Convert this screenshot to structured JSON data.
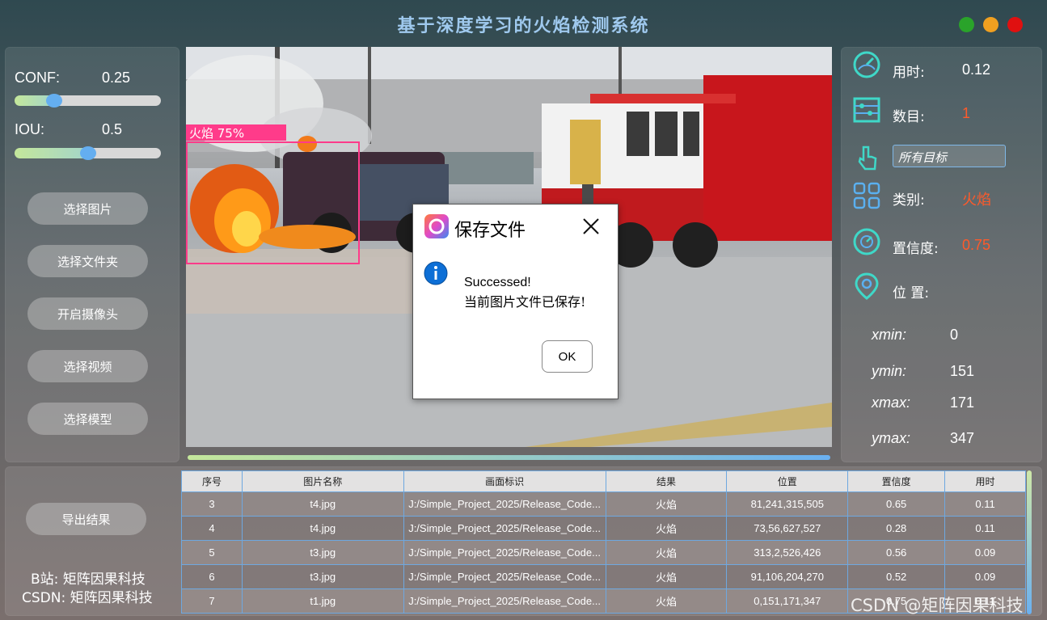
{
  "window": {
    "title": "基于深度学习的火焰检测系统"
  },
  "colors": {
    "dot_green": "#2aa32a",
    "dot_orange": "#f0a020",
    "dot_red": "#e01010",
    "accent": "#ff5a2a"
  },
  "left_panel": {
    "conf_label": "CONF:",
    "conf_value": "0.25",
    "conf_level": 0.25,
    "iou_label": "IOU:",
    "iou_value": "0.5",
    "iou_level": 0.5,
    "buttons": [
      "选择图片",
      "选择文件夹",
      "开启摄像头",
      "选择视频",
      "选择模型"
    ]
  },
  "image_view": {
    "detection_label": "火焰  75%"
  },
  "right_panel": {
    "time_label": "用时:",
    "time_value": "0.12",
    "count_label": "数目:",
    "count_value": "1",
    "target_select": "所有目标",
    "class_label": "类别:",
    "class_value": "火焰",
    "conf_label": "置信度:",
    "conf_value": "0.75",
    "pos_label": "位 置:",
    "coords": [
      {
        "label": "xmin:",
        "value": "0"
      },
      {
        "label": "ymin:",
        "value": "151"
      },
      {
        "label": "xmax:",
        "value": "171"
      },
      {
        "label": "ymax:",
        "value": "347"
      }
    ]
  },
  "bottom_left": {
    "export_button": "导出结果",
    "credit_bilibili": "B站: 矩阵因果科技",
    "credit_csdn": "CSDN: 矩阵因果科技"
  },
  "table": {
    "headers": [
      "序号",
      "图片名称",
      "画面标识",
      "结果",
      "位置",
      "置信度",
      "用时"
    ],
    "rows": [
      [
        "3",
        "t4.jpg",
        "J:/Simple_Project_2025/Release_Code...",
        "火焰",
        "81,241,315,505",
        "0.65",
        "0.11"
      ],
      [
        "4",
        "t4.jpg",
        "J:/Simple_Project_2025/Release_Code...",
        "火焰",
        "73,56,627,527",
        "0.28",
        "0.11"
      ],
      [
        "5",
        "t3.jpg",
        "J:/Simple_Project_2025/Release_Code...",
        "火焰",
        "313,2,526,426",
        "0.56",
        "0.09"
      ],
      [
        "6",
        "t3.jpg",
        "J:/Simple_Project_2025/Release_Code...",
        "火焰",
        "91,106,204,270",
        "0.52",
        "0.09"
      ],
      [
        "7",
        "t1.jpg",
        "J:/Simple_Project_2025/Release_Code...",
        "火焰",
        "0,151,171,347",
        "0.75",
        "0.11"
      ]
    ]
  },
  "dialog": {
    "title": "保存文件",
    "line1": "Successed!",
    "line2": "当前图片文件已保存!",
    "ok_label": "OK"
  },
  "watermark": "CSDN @矩阵因果科技"
}
